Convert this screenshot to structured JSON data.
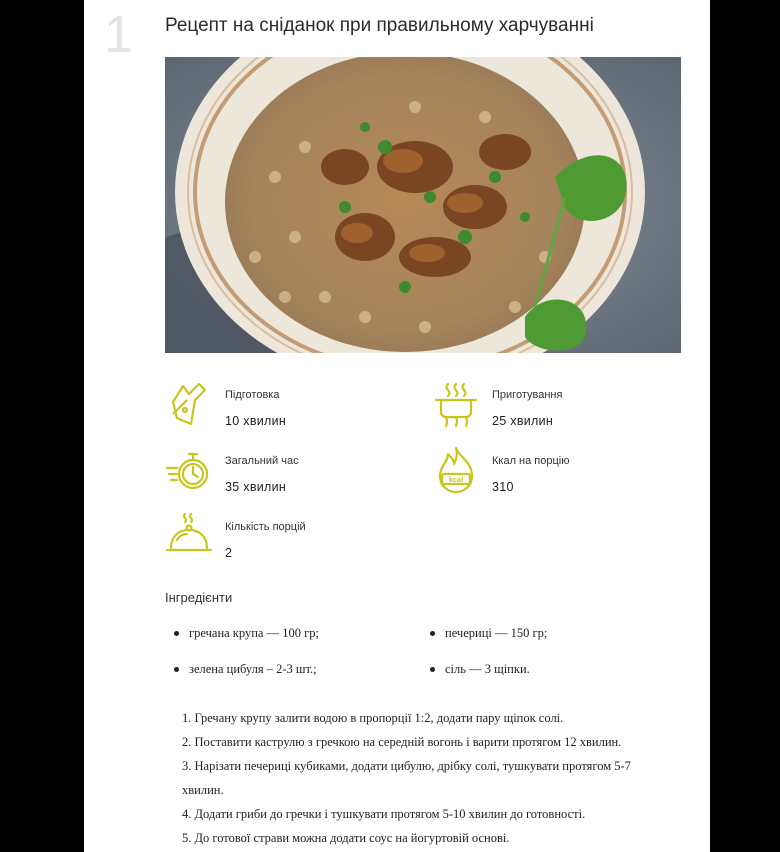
{
  "step": {
    "number": "1"
  },
  "recipe": {
    "title": "Рецепт на сніданок при правильному харчуванні"
  },
  "info": {
    "prep": {
      "label": "Підготовка",
      "value": "10 хвилин",
      "icon": "cutting-board-knife-icon"
    },
    "cook": {
      "label": "Приготування",
      "value": "25 хвилин",
      "icon": "cooking-pot-icon"
    },
    "total": {
      "label": "Загальний час",
      "value": "35 хвилин",
      "icon": "stopwatch-icon"
    },
    "kcal": {
      "label": "Ккал на порцію",
      "value": "310",
      "icon": "kcal-flame-icon"
    },
    "servings": {
      "label": "Кількість порцій",
      "value": "2",
      "icon": "serving-cloche-icon"
    }
  },
  "ingredients": {
    "heading": "Інгредієнти",
    "items": [
      "гречана крупа — 100 гр;",
      "печериці — 150 гр;",
      "зелена цибуля – 2-3 шт.;",
      "сіль — 3 щіпки."
    ]
  },
  "steps": [
    "1. Гречану крупу залити водою в пропорції 1:2, додати пару щіпок солі.",
    "2. Поставити каструлю з гречкою на середній вогонь і варити протягом 12 хвилин.",
    "3. Нарізати печериці кубиками, додати цибулю, дрібку солі, тушкувати протягом 5-7 хвилин.",
    "4. Додати гриби до гречки і тушкувати протягом 5-10 хвилин до готовності.",
    "5. До готової страви можна додати соус на йогуртовій основі."
  ],
  "colors": {
    "icon": "#c6c71a",
    "background": "#000000",
    "card": "#ffffff"
  }
}
